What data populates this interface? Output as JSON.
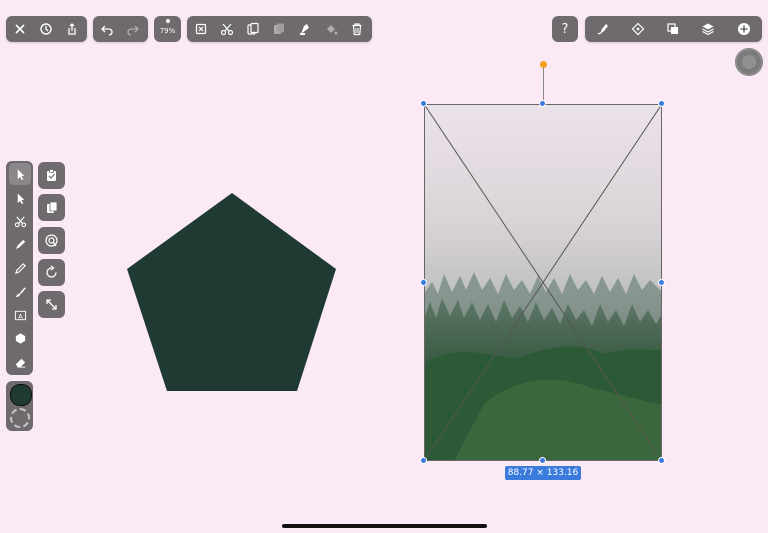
{
  "status_bar": {
    "left": "",
    "right": ""
  },
  "top_toolbar": {
    "file_group": [
      {
        "name": "close-icon"
      },
      {
        "name": "history-icon"
      },
      {
        "name": "share-icon"
      }
    ],
    "history_group": [
      {
        "name": "undo-icon"
      },
      {
        "name": "redo-icon"
      }
    ],
    "zoom_label": "79%",
    "edit_group": [
      {
        "name": "deselect-icon"
      },
      {
        "name": "cut-icon"
      },
      {
        "name": "copy-icon"
      },
      {
        "name": "paste-icon"
      },
      {
        "name": "paint-bucket-icon"
      },
      {
        "name": "fill-icon"
      },
      {
        "name": "trash-icon"
      }
    ],
    "help_label": "?",
    "right_group": [
      {
        "name": "style-icon"
      },
      {
        "name": "node-icon"
      },
      {
        "name": "arrange-icon"
      },
      {
        "name": "layers-icon"
      },
      {
        "name": "add-icon"
      }
    ]
  },
  "tools": [
    {
      "name": "select-tool"
    },
    {
      "name": "direct-select-tool"
    },
    {
      "name": "scissors-tool"
    },
    {
      "name": "pen-tool"
    },
    {
      "name": "pencil-tool"
    },
    {
      "name": "brush-tool"
    },
    {
      "name": "text-tool"
    },
    {
      "name": "shape-tool"
    },
    {
      "name": "eraser-tool"
    }
  ],
  "text_tool_glyph": "A",
  "colors": {
    "background": "#fbe9f5",
    "fill": "#1f3a33",
    "selection": "#3a7bdc",
    "rotation_handle": "#f0a020"
  },
  "selection_dimensions": "88.77 × 133.16"
}
